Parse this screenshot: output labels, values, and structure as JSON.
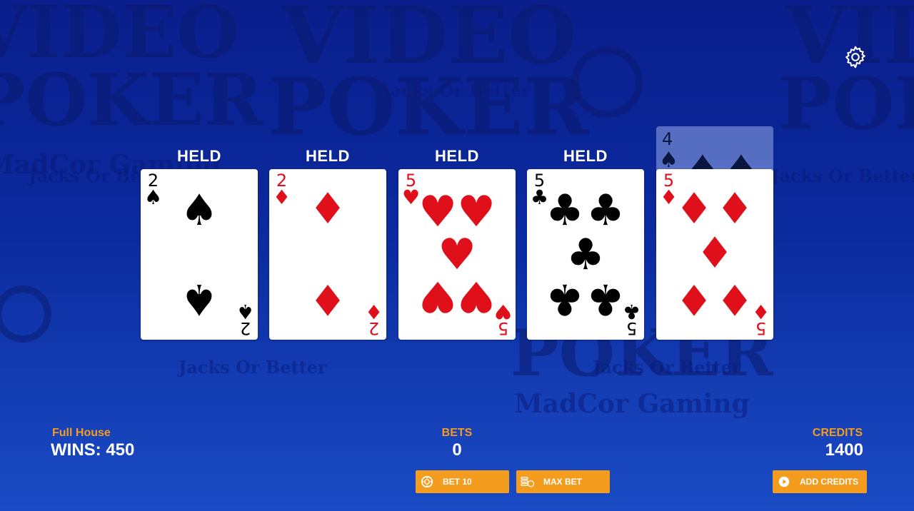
{
  "colors": {
    "accent": "#f39c1e",
    "red_suit": "#e0101a",
    "black_suit": "#000000"
  },
  "settings": {
    "icon": "gear-icon"
  },
  "cards": [
    {
      "held_label": "HELD",
      "rank": "2",
      "suit": "♠",
      "suit_name": "spades",
      "color": "black"
    },
    {
      "held_label": "HELD",
      "rank": "2",
      "suit": "♦",
      "suit_name": "diamonds",
      "color": "red"
    },
    {
      "held_label": "HELD",
      "rank": "5",
      "suit": "♥",
      "suit_name": "hearts",
      "color": "red"
    },
    {
      "held_label": "HELD",
      "rank": "5",
      "suit": "♣",
      "suit_name": "clubs",
      "color": "black"
    },
    {
      "held_label": "",
      "rank": "5",
      "suit": "♦",
      "suit_name": "diamonds",
      "color": "red"
    }
  ],
  "discarded_card": {
    "rank": "4",
    "suit": "♠"
  },
  "status": {
    "hand_name": "Full House",
    "wins": "WINS: 450",
    "bets_label": "BETS",
    "bets_value": "0",
    "credits_label": "CREDITS",
    "credits_value": "1400"
  },
  "buttons": {
    "bet10": "BET 10",
    "max_bet": "MAX BET",
    "add_credits": "ADD CREDITS"
  },
  "background": {
    "logo_text_1": "VIDEO",
    "logo_text_2": "POKER",
    "subtitle": "Jacks Or Better",
    "subtitle2": "Training Simulator",
    "brand": "MadCor Gaming"
  }
}
